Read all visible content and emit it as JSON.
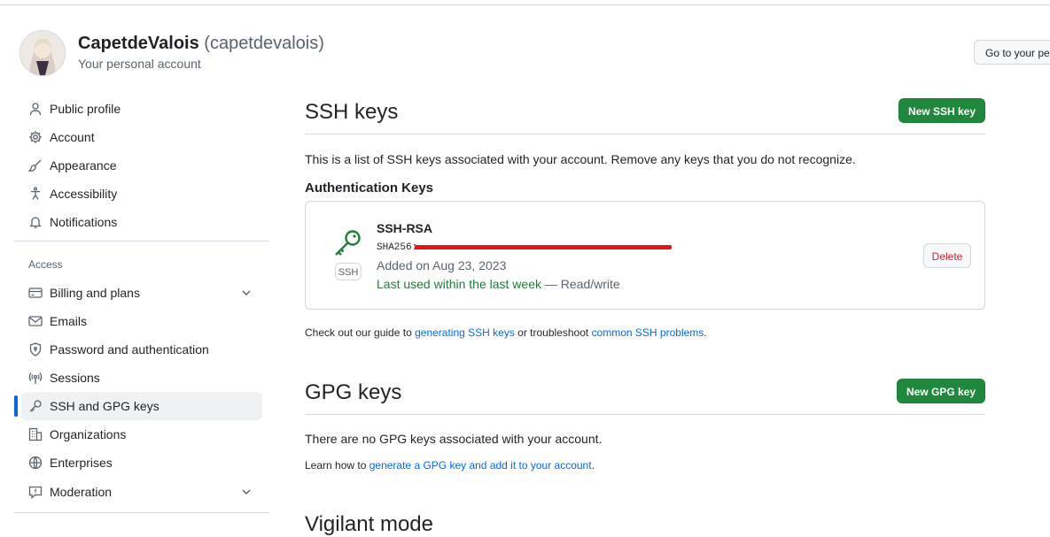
{
  "user": {
    "name": "CapetdeValois",
    "handle": "(capetdevalois)",
    "subtitle": "Your personal account",
    "goto_button": "Go to your personal profile"
  },
  "sidebar": {
    "items": [
      {
        "label": "Public profile",
        "icon": "person-icon"
      },
      {
        "label": "Account",
        "icon": "gear-icon"
      },
      {
        "label": "Appearance",
        "icon": "paintbrush-icon"
      },
      {
        "label": "Accessibility",
        "icon": "accessibility-icon"
      },
      {
        "label": "Notifications",
        "icon": "bell-icon"
      }
    ],
    "access_heading": "Access",
    "access_items": [
      {
        "label": "Billing and plans",
        "icon": "credit-card-icon",
        "expandable": true
      },
      {
        "label": "Emails",
        "icon": "mail-icon"
      },
      {
        "label": "Password and authentication",
        "icon": "shield-lock-icon"
      },
      {
        "label": "Sessions",
        "icon": "broadcast-icon"
      },
      {
        "label": "SSH and GPG keys",
        "icon": "key-icon",
        "active": true
      },
      {
        "label": "Organizations",
        "icon": "organization-icon"
      },
      {
        "label": "Enterprises",
        "icon": "globe-icon"
      },
      {
        "label": "Moderation",
        "icon": "report-icon",
        "expandable": true
      }
    ]
  },
  "ssh": {
    "title": "SSH keys",
    "new_button": "New SSH key",
    "description": "This is a list of SSH keys associated with your account. Remove any keys that you do not recognize.",
    "auth_heading": "Authentication Keys",
    "key": {
      "type": "SSH-RSA",
      "fingerprint_prefix": "SHA256:",
      "added": "Added on Aug 23, 2023",
      "last_used": "Last used within the last week",
      "access": "— Read/write",
      "badge": "SSH",
      "delete": "Delete"
    },
    "guide_prefix": "Check out our guide to",
    "guide_link1": "generating SSH keys",
    "guide_mid": "or troubleshoot",
    "guide_link2": "common SSH problems",
    "guide_end": "."
  },
  "gpg": {
    "title": "GPG keys",
    "new_button": "New GPG key",
    "empty": "There are no GPG keys associated with your account.",
    "learn_prefix": "Learn how to",
    "learn_link": "generate a GPG key and add it to your account",
    "learn_end": "."
  },
  "vigilant": {
    "title": "Vigilant mode"
  },
  "colors": {
    "accent": "#0969da",
    "green": "#1f883d",
    "danger": "#cf222e"
  }
}
